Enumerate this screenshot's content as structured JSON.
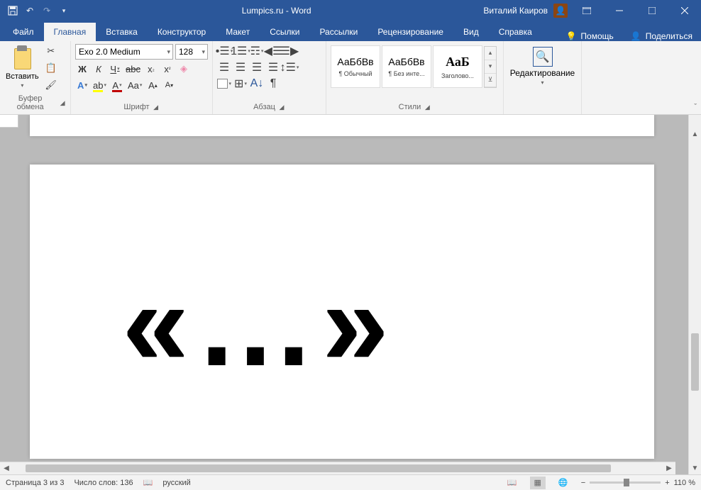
{
  "title": "Lumpics.ru - Word",
  "user": "Виталий Каиров",
  "tabs": {
    "file": "Файл",
    "home": "Главная",
    "insert": "Вставка",
    "design": "Конструктор",
    "layout": "Макет",
    "references": "Ссылки",
    "mailings": "Рассылки",
    "review": "Рецензирование",
    "view": "Вид",
    "help": "Справка",
    "tellme": "Помощь",
    "share": "Поделиться"
  },
  "ribbon": {
    "clipboard": {
      "paste": "Вставить",
      "label": "Буфер обмена"
    },
    "font": {
      "name": "Exo 2.0 Medium",
      "size": "128",
      "label": "Шрифт",
      "bold": "Ж",
      "italic": "К",
      "underline": "Ч"
    },
    "paragraph": {
      "label": "Абзац"
    },
    "styles": {
      "label": "Стили",
      "items": [
        {
          "preview": "АаБбВв",
          "name": "¶ Обычный"
        },
        {
          "preview": "АаБбВв",
          "name": "¶ Без инте..."
        },
        {
          "preview": "АаБ",
          "name": "Заголово..."
        }
      ]
    },
    "editing": {
      "label": "Редактирование"
    }
  },
  "document": {
    "text": "«…»"
  },
  "status": {
    "page": "Страница 3 из 3",
    "words": "Число слов: 136",
    "language": "русский",
    "zoom": "110 %"
  }
}
